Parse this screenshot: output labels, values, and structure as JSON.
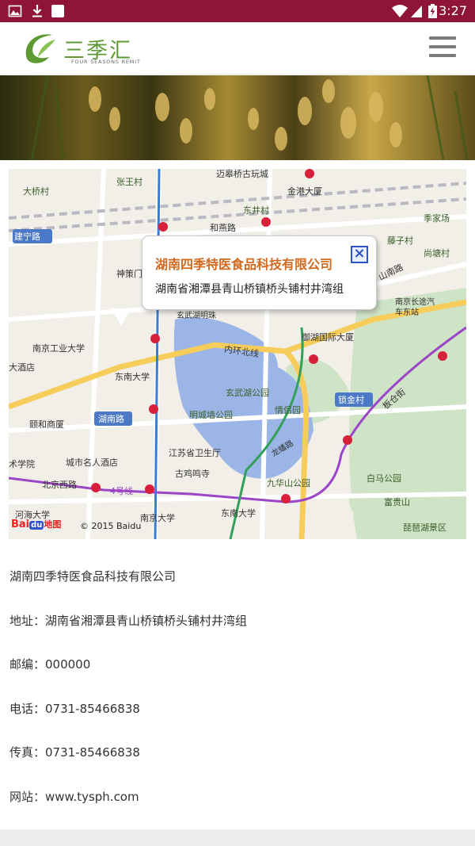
{
  "status_bar": {
    "time": "3:27",
    "left_icons": [
      "image-icon",
      "download-icon",
      "square-icon"
    ],
    "right_icons": [
      "wifi-icon",
      "signal-icon",
      "battery-icon"
    ]
  },
  "header": {
    "logo_text": "三季汇",
    "logo_subtitle": "FOUR SEASONS REMIT",
    "menu_icon": "hamburger-menu-icon"
  },
  "map": {
    "popup_title": "湖南四季特医食品科技有限公司",
    "popup_address": "湖南省湘潭县青山桥镇桥头铺村井湾组",
    "copyright": "© 2015 Baidu",
    "baidu_logo": {
      "part1": "Bai",
      "part2": "du",
      "part3": "地图"
    },
    "labels": {
      "l1": "大桥村",
      "l2": "张王村",
      "l3": "迈皋桥古玩城",
      "l4": "金港大厦",
      "l5": "东井村",
      "l6": "和燕路",
      "l7": "季家场",
      "l8": "藤子村",
      "l9": "建宁路",
      "l10": "尚塘村",
      "l11": "神策门",
      "l12": "山南路",
      "l13": "南京长途汽车东站",
      "l14": "玄武湖明珠",
      "l15": "御湖国际大厦",
      "l16": "南京工业大学",
      "l17": "内环北线",
      "l18": "大酒店",
      "l19": "东南大学",
      "l20": "玄武湖公园",
      "l21": "锁金村",
      "l22": "板仓街",
      "l23": "颐和商厦",
      "l24": "湖南路",
      "l25": "明城墙公园",
      "l26": "情侣园",
      "l27": "术学院",
      "l28": "城市名人酒店",
      "l29": "江苏省卫生厅",
      "l30": "古鸡鸣寺",
      "l31": "白马公园",
      "l32": "北京西路",
      "l33": "4号线",
      "l34": "九华山公园",
      "l35": "富贵山",
      "l36": "河海大学",
      "l37": "南京大学",
      "l38": "东南大学",
      "l39": "琵琶湖景区",
      "l40": "龙蟠路"
    }
  },
  "contact": {
    "company": "湖南四季特医食品科技有限公司",
    "address": "地址：湖南省湘潭县青山桥镇桥头铺村井湾组",
    "postcode": "邮编：000000",
    "phone": "电话：0731-85466838",
    "fax": "传真：0731-85466838",
    "website": "网站：www.tysph.com"
  },
  "colors": {
    "status_bar": "#8f1538",
    "logo_green": "#5d9a33",
    "popup_title": "#d2691e",
    "lake_blue": "#9bb6e6",
    "metro_purple": "#9b46c8",
    "road_yellow": "#f6cc5a"
  }
}
